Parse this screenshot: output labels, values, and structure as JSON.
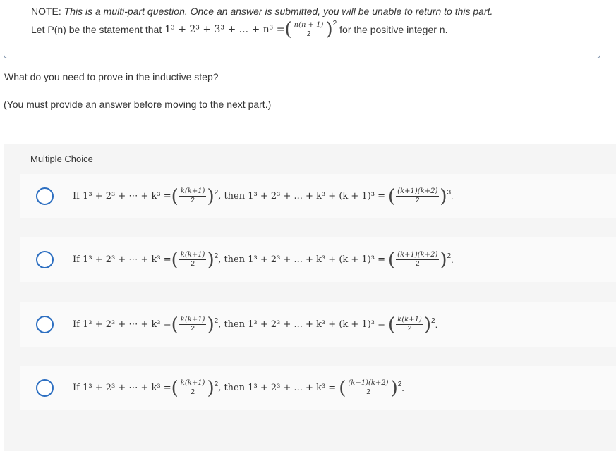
{
  "note": {
    "label": "NOTE:",
    "text": "This is a multi-part question. Once an answer is submitted, you will be unable to return to this part."
  },
  "statement": {
    "prefix": "Let P(n) be the statement that",
    "lhs": "1³ + 2³ + 3³ + ... + n³ =",
    "frac_num": "n(n + 1)",
    "frac_den": "2",
    "power": "2",
    "suffix": "for the positive integer n."
  },
  "question": "What do you need to prove in the inductive step?",
  "instruction": "(You must provide an answer before moving to the next part.)",
  "multiple_choice": {
    "header": "Multiple Choice",
    "options": [
      {
        "if_part": "If 1³ + 2³ + ⋯ + k³ =",
        "hyp_num": "k(k+1)",
        "hyp_den": "2",
        "hyp_pow": "2",
        "then_part": ", then 1³ + 2³ + ... + k³ + (k + 1)³ =",
        "res_num": "(k+1)(k+2)",
        "res_den": "2",
        "res_pow": "3"
      },
      {
        "if_part": "If 1³ + 2³ + ⋯ + k³ =",
        "hyp_num": "k(k+1)",
        "hyp_den": "2",
        "hyp_pow": "2",
        "then_part": ", then 1³ + 2³ + ... + k³ + (k + 1)³ =",
        "res_num": "(k+1)(k+2)",
        "res_den": "2",
        "res_pow": "2"
      },
      {
        "if_part": "If 1³ + 2³ + ⋯ + k³ =",
        "hyp_num": "k(k+1)",
        "hyp_den": "2",
        "hyp_pow": "2",
        "then_part": ", then 1³ + 2³ + ... + k³ + (k + 1)³ =",
        "res_num": "k(k+1)",
        "res_den": "2",
        "res_pow": "2"
      },
      {
        "if_part": "If 1³ + 2³ + ⋯ + k³ =",
        "hyp_num": "k(k+1)",
        "hyp_den": "2",
        "hyp_pow": "2",
        "then_part": ", then 1³ + 2³ + ... + k³ =",
        "res_num": "(k+1)(k+2)",
        "res_den": "2",
        "res_pow": "2"
      }
    ]
  },
  "colors": {
    "radio_border": "#2d6fc1",
    "panel_bg": "#f5f5f5",
    "box_border": "#7a8ea8"
  }
}
